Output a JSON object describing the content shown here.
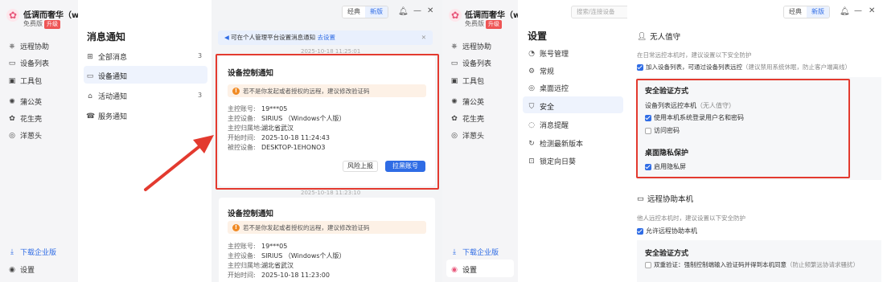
{
  "left_app": {
    "app_name": "低调而奢华（w...",
    "edition": "免费版",
    "upgrade": "升级",
    "nav": [
      "远程协助",
      "设备列表",
      "工具包",
      "蒲公英",
      "花生壳",
      "洋葱头"
    ],
    "download": "下载企业版",
    "settings": "设置",
    "topbar": {
      "classic": "经典",
      "new": "新版"
    },
    "notice_title": "消息通知",
    "menu": [
      {
        "label": "全部消息",
        "count": "3"
      },
      {
        "label": "设备通知",
        "count": ""
      },
      {
        "label": "活动通知",
        "count": "3"
      },
      {
        "label": "服务通知",
        "count": ""
      }
    ],
    "banner": {
      "text": "可在个人管理平台设置消息通知",
      "link": "去设置"
    },
    "stamp_top": "2025-10-18 11:25:01",
    "card1": {
      "title": "设备控制通知",
      "warning": "若不是你发起或者授权的远程，建议修改验证码",
      "rows": [
        {
          "k": "主控账号:",
          "v": "19***05"
        },
        {
          "k": "主控设备:",
          "v": "SIRIUS （Windows个人版）"
        },
        {
          "k": "主控归属地:",
          "v": "湖北省武汉"
        },
        {
          "k": "开始时间:",
          "v": "2025-10-18 11:24:43"
        },
        {
          "k": "被控设备:",
          "v": "DESKTOP-1EHONO3"
        }
      ],
      "btn_report": "风险上报",
      "btn_block": "拉黑账号"
    },
    "stamp_mid": "2025-10-18 11:23:10",
    "card2": {
      "title": "设备控制通知",
      "warning": "若不是你发起或者授权的远程，建议修改验证码",
      "rows": [
        {
          "k": "主控账号:",
          "v": "19***05"
        },
        {
          "k": "主控设备:",
          "v": "SIRIUS （Windows个人版）"
        },
        {
          "k": "主控归属地:",
          "v": "湖北省武汉"
        },
        {
          "k": "开始时间:",
          "v": "2025-10-18 11:23:00"
        }
      ]
    }
  },
  "right_app": {
    "app_name": "低调而奢华（w...",
    "edition": "免费版",
    "upgrade": "升级",
    "search_placeholder": "搜索/连接设备",
    "topbar": {
      "classic": "经典",
      "new": "新版"
    },
    "nav": [
      "远程协助",
      "设备列表",
      "工具包",
      "蒲公英",
      "花生壳",
      "洋葱头"
    ],
    "download": "下载企业版",
    "settings": "设置",
    "settings_title": "设置",
    "menu": [
      "账号管理",
      "常规",
      "桌面远控",
      "安全",
      "消息提醒",
      "检测最新版本",
      "锁定向日葵"
    ],
    "unattended": {
      "head": "无人值守",
      "desc": "在日常远控本机时，建议设置以下安全防护",
      "add_list": "加入设备列表，可通过设备列表远控",
      "add_list_note": "（建议禁用系统休眠，防止客户端离线）",
      "auth_title": "安全验证方式",
      "auth_desc": "设备列表远控本机",
      "auth_desc_note": "（无人值守）",
      "opt_syslogin": "使用本机系统登录用户名和密码",
      "opt_password": "访问密码",
      "privacy_title": "桌面隐私保护",
      "privacy_opt": "启用隐私屏"
    },
    "remote_assist": {
      "head": "远程协助本机",
      "desc": "他人远控本机时，建议设置以下安全防护",
      "allow": "允许远程协助本机",
      "auth_title": "安全验证方式",
      "dual_verify": "双重验证：强制控制端输入验证码并得到本机同意",
      "dual_verify_note": "（防止频繁远协请求骚扰）"
    }
  },
  "colors": {
    "accent": "#2f6ce5",
    "highlight": "#e33a2f",
    "warning_bg": "#fdf1e6"
  }
}
